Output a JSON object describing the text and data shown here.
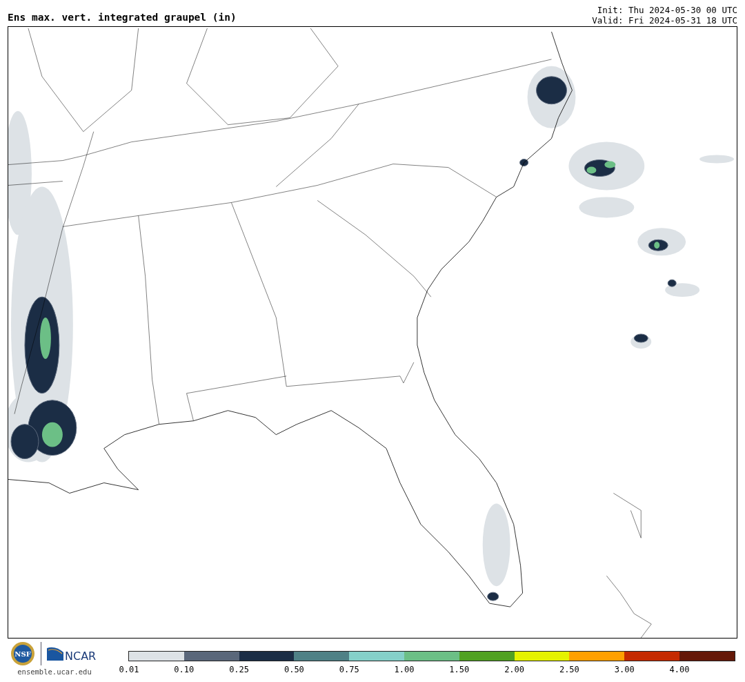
{
  "header": {
    "title": "Ens max. vert. integrated graupel (in)",
    "init": "Init: Thu 2024-05-30 00 UTC",
    "valid": "Valid: Fri 2024-05-31 18 UTC"
  },
  "logos": {
    "nsf": "NSF",
    "ncar": "NCAR",
    "url": "ensemble.ucar.edu"
  },
  "colorbar": [
    {
      "label": "0.01",
      "color": "#dde2e6"
    },
    {
      "label": "0.10",
      "color": "#5a677a"
    },
    {
      "label": "0.25",
      "color": "#1b2d45"
    },
    {
      "label": "0.50",
      "color": "#4f8186"
    },
    {
      "label": "0.75",
      "color": "#85d0c9"
    },
    {
      "label": "1.00",
      "color": "#6cbf86"
    },
    {
      "label": "1.50",
      "color": "#51a122"
    },
    {
      "label": "2.00",
      "color": "#e5f200"
    },
    {
      "label": "2.50",
      "color": "#ffa000"
    },
    {
      "label": "3.00",
      "color": "#c52a00"
    },
    {
      "label": "4.00",
      "color": "#641808"
    }
  ]
}
